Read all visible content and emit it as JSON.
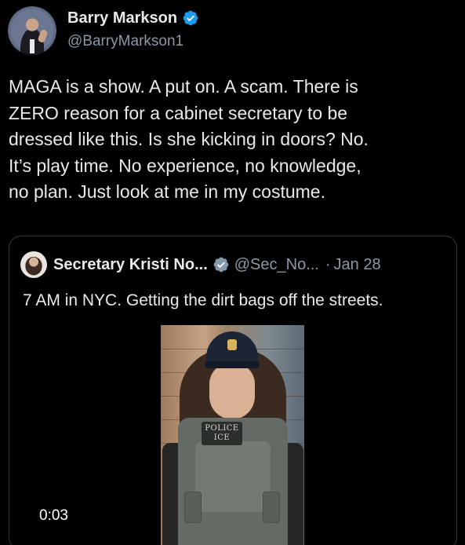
{
  "author": {
    "display_name": "Barry Markson",
    "handle": "@BarryMarkson1",
    "verified_icon": "verified-badge-icon"
  },
  "tweet": {
    "lines": [
      "MAGA is a show. A put on. A scam. There is",
      "ZERO reason for a cabinet secretary to be",
      "dressed like this. Is she kicking in doors? No.",
      "It’s play time. No experience, no knowledge,",
      "no plan. Just look at me in my costume."
    ]
  },
  "quoted": {
    "display_name": "Secretary Kristi No...",
    "handle": "@Sec_No...",
    "separator": "·",
    "date": "Jan 28",
    "text": "7 AM in NYC. Getting the dirt bags off the streets.",
    "video": {
      "duration": "0:03",
      "patch_line1": "POLICE",
      "patch_line2": "ICE"
    }
  },
  "colors": {
    "background": "#000000",
    "text_primary": "#e7e9ea",
    "text_secondary": "#8b98a5",
    "verified_blue": "#1d9bf0",
    "border": "#333639"
  }
}
